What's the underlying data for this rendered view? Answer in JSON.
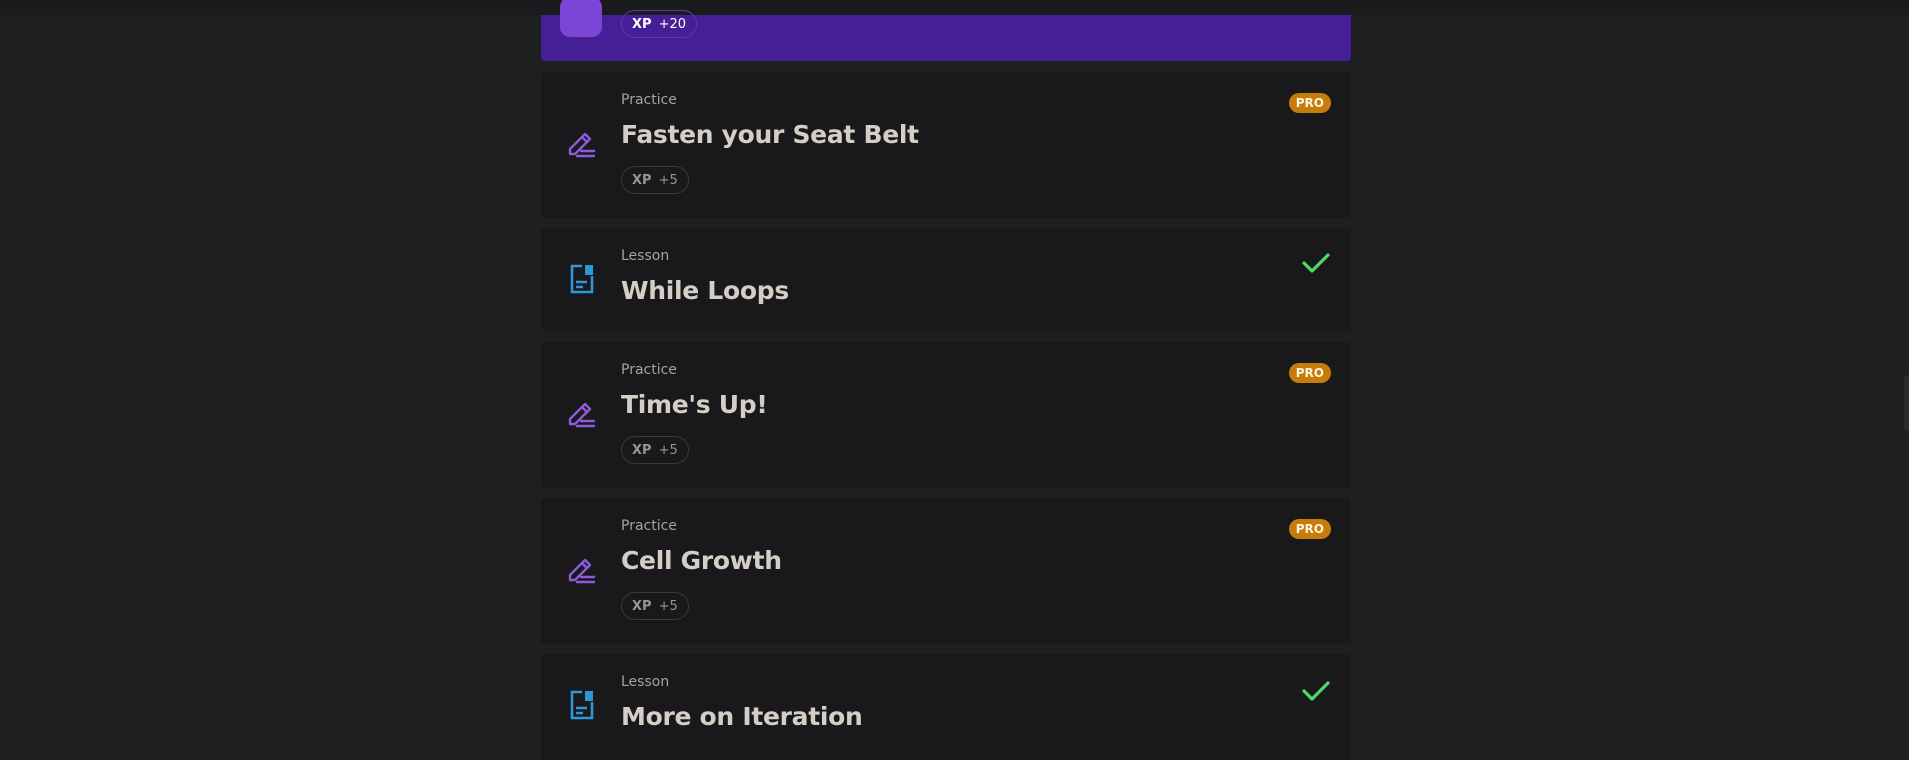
{
  "colors": {
    "background": "#1e1f21",
    "card": "#19191b",
    "active_card": "#461e96",
    "practice_icon": "#8b5bd8",
    "lesson_icon": "#2f97d8",
    "pro_badge": "#c67c0b",
    "check": "#4cd964"
  },
  "active_item": {
    "xp_label": "XP",
    "xp_value": "+20"
  },
  "items": [
    {
      "type": "Practice",
      "title": "Fasten your Seat Belt",
      "icon": "pencil-icon",
      "badge": "PRO",
      "xp_label": "XP",
      "xp_value": "+5"
    },
    {
      "type": "Lesson",
      "title": "While Loops",
      "icon": "document-icon",
      "completed": true
    },
    {
      "type": "Practice",
      "title": "Time's Up!",
      "icon": "pencil-icon",
      "badge": "PRO",
      "xp_label": "XP",
      "xp_value": "+5"
    },
    {
      "type": "Practice",
      "title": "Cell Growth",
      "icon": "pencil-icon",
      "badge": "PRO",
      "xp_label": "XP",
      "xp_value": "+5"
    },
    {
      "type": "Lesson",
      "title": "More on Iteration",
      "icon": "document-icon",
      "completed": true
    }
  ]
}
